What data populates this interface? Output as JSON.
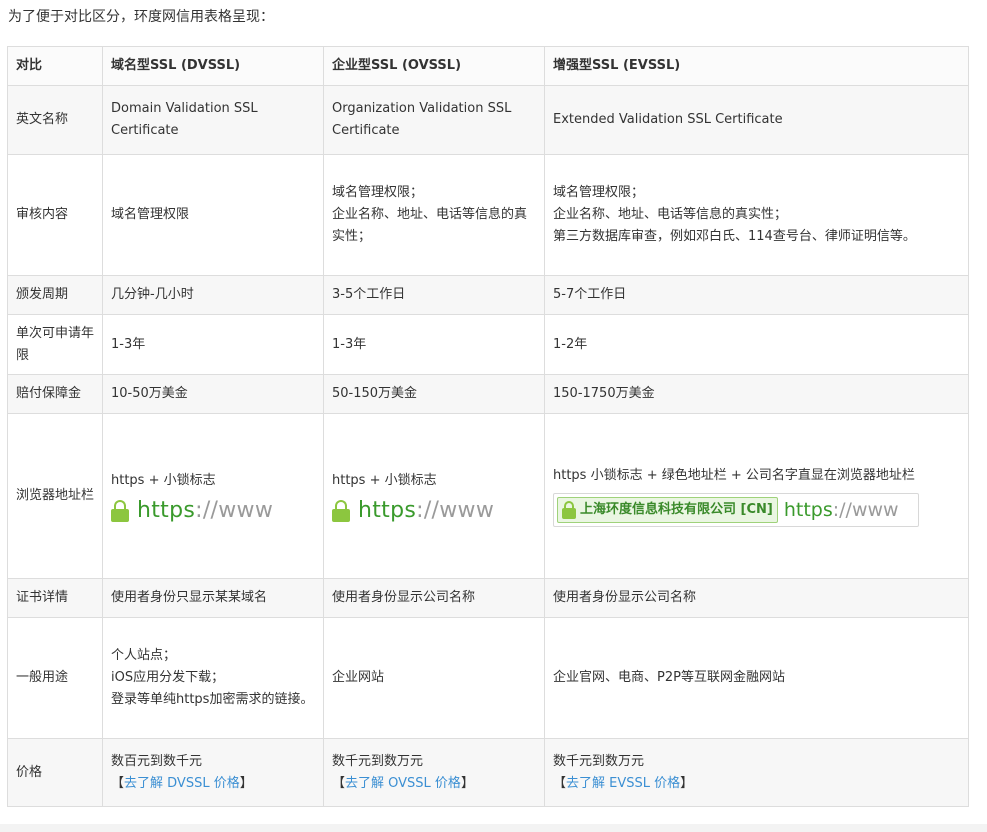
{
  "intro": "为了便于对比区分，环度网信用表格呈现：",
  "header": {
    "label": "对比",
    "dv": "域名型SSL (DVSSL)",
    "ov": "企业型SSL (OVSSL)",
    "ev": "增强型SSL (EVSSL)"
  },
  "rows": {
    "name": {
      "label": "英文名称",
      "dv": "Domain Validation SSL Certificate",
      "ov": "Organization Validation SSL Certificate",
      "ev": "Extended Validation SSL Certificate"
    },
    "audit": {
      "label": "审核内容",
      "dv": "域名管理权限",
      "ov_1": "域名管理权限；",
      "ov_2": "企业名称、地址、电话等信息的真实性；",
      "ev_1": "域名管理权限；",
      "ev_2": "企业名称、地址、电话等信息的真实性；",
      "ev_3": "第三方数据库审查，例如邓白氏、114查号台、律师证明信等。"
    },
    "period": {
      "label": "颁发周期",
      "dv": "几分钟-几小时",
      "ov": "3-5个工作日",
      "ev": "5-7个工作日"
    },
    "years": {
      "label": "单次可申请年限",
      "dv": "1-3年",
      "ov": "1-3年",
      "ev": "1-2年"
    },
    "warranty": {
      "label": "赔付保障金",
      "dv": "10-50万美金",
      "ov": "50-150万美金",
      "ev": "150-1750万美金"
    },
    "browser": {
      "label": "浏览器地址栏",
      "dv": "https + 小锁标志",
      "ov": "https + 小锁标志",
      "ev": "https 小锁标志 + 绿色地址栏 + 公司名字直显在浏览器地址栏",
      "url_https": "https",
      "url_rest": "://www",
      "ev_company": "上海环度信息科技有限公司 [CN]"
    },
    "cert": {
      "label": "证书详情",
      "dv": "使用者身份只显示某某域名",
      "ov": "使用者身份显示公司名称",
      "ev": "使用者身份显示公司名称"
    },
    "usage": {
      "label": "一般用途",
      "dv_1": "个人站点；",
      "dv_2": "iOS应用分发下载；",
      "dv_3": "登录等单纯https加密需求的链接。",
      "ov": "企业网站",
      "ev": "企业官网、电商、P2P等互联网金融网站"
    },
    "price": {
      "label": "价格",
      "dv": "数百元到数千元",
      "ov": "数千元到数万元",
      "ev": "数千元到数万元",
      "bracket_open": "【",
      "bracket_close": "】",
      "dv_link": "去了解 DVSSL 价格",
      "ov_link": "去了解 OVSSL 价格",
      "ev_link": "去了解 EVSSL 价格"
    }
  },
  "colors": {
    "link": "#3b8fd3",
    "https_green": "#3a9a2c",
    "lock_green": "#8cc63f",
    "border": "#dddddd"
  }
}
